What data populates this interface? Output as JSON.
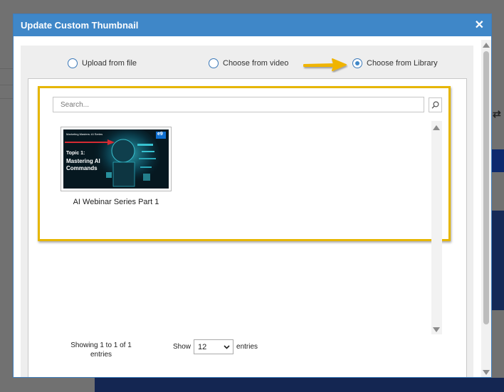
{
  "dialog": {
    "title": "Update Custom Thumbnail",
    "close_icon": "close-icon"
  },
  "source_options": [
    {
      "label": "Upload from file",
      "selected": false
    },
    {
      "label": "Choose from video",
      "selected": false
    },
    {
      "label": "Choose from Library",
      "selected": true
    }
  ],
  "annotation": {
    "arrow_color": "#f0b400",
    "highlight_color": "#e6b600"
  },
  "library": {
    "search_placeholder": "Search...",
    "search_icon": "search-icon",
    "items": [
      {
        "caption": "AI Webinar Series Part 1",
        "thumbnail": {
          "series": "Marketing Masters: AI Series",
          "topic": "Topic 1:",
          "title_line1": "Mastering AI",
          "title_line2": "Commands",
          "logo": "e9"
        }
      }
    ],
    "showing_text": "Showing 1 to 1 of 1 entries",
    "show_label": "Show",
    "page_size": "12",
    "entries_label": "entries"
  },
  "colors": {
    "header": "#3f87c8",
    "radio": "#3a78b8"
  }
}
